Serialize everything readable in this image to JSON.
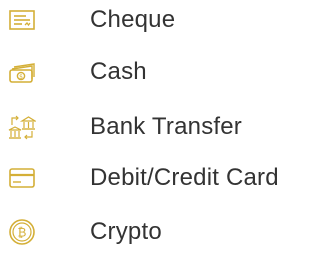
{
  "accent_color": "#D4AF37",
  "payment_methods": [
    {
      "label": "Cheque",
      "icon": "cheque-icon"
    },
    {
      "label": "Cash",
      "icon": "cash-icon"
    },
    {
      "label": "Bank Transfer",
      "icon": "bank-transfer-icon"
    },
    {
      "label": "Debit/Credit Card",
      "icon": "card-icon"
    },
    {
      "label": "Crypto",
      "icon": "bitcoin-icon"
    }
  ]
}
